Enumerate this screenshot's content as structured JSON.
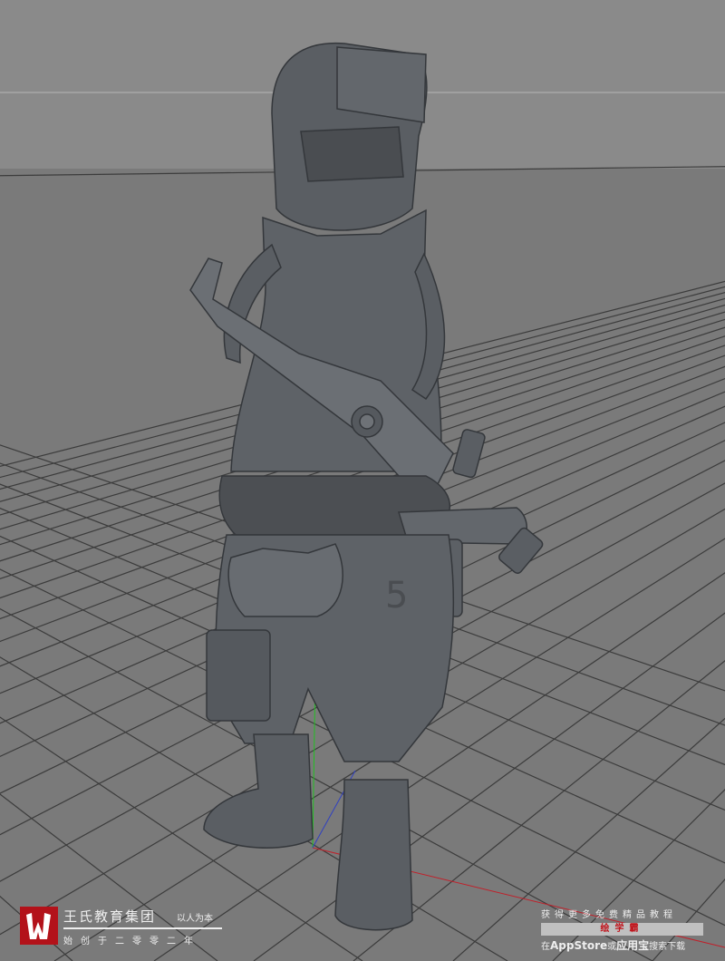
{
  "viewport": {
    "background_color": "#8a8a8a",
    "floor_color": "#7a7a7a",
    "grid_line_color": "#3c3c3c",
    "model_color": "#5a5e63",
    "axis_colors": {
      "x": "#c0202a",
      "y": "#20c020",
      "z": "#3040c0"
    },
    "model_number_text": "5"
  },
  "watermark_left": {
    "logo_icon": "wangshi-w-logo",
    "logo_color": "#b3121a",
    "brand": "王氏教育集团",
    "motto": "以人为本",
    "since": "始创于二零零二年"
  },
  "watermark_right": {
    "promo": "获得更多免费精品教程",
    "app_name": "绘学霸",
    "store_prefix": "在",
    "store_name": "AppStore",
    "store_middle": "或",
    "store_alt": "应用宝",
    "store_suffix": "搜索下载"
  }
}
